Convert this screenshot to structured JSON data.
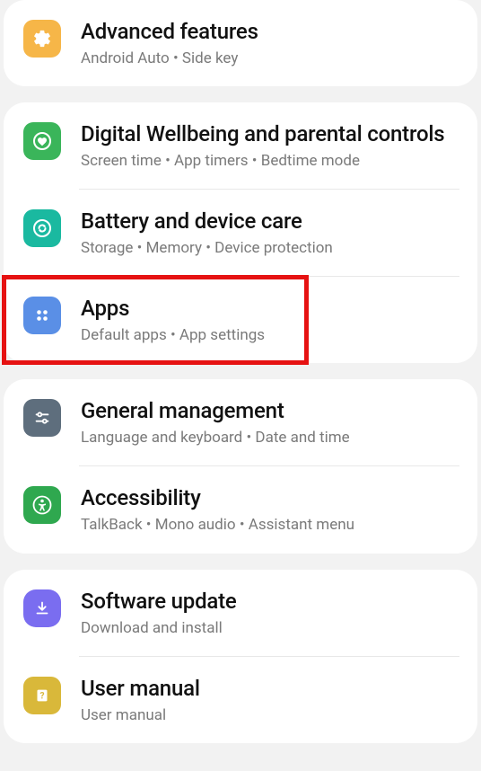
{
  "groups": [
    {
      "items": [
        {
          "title": "Advanced features",
          "subtitle": "Android Auto  •  Side key"
        }
      ]
    },
    {
      "items": [
        {
          "title": "Digital Wellbeing and parental controls",
          "subtitle": "Screen time  •  App timers  •  Bedtime mode"
        },
        {
          "title": "Battery and device care",
          "subtitle": "Storage  •  Memory  •  Device protection"
        },
        {
          "title": "Apps",
          "subtitle": "Default apps  •  App settings",
          "highlighted": true
        }
      ]
    },
    {
      "items": [
        {
          "title": "General management",
          "subtitle": "Language and keyboard  •  Date and time"
        },
        {
          "title": "Accessibility",
          "subtitle": "TalkBack  •  Mono audio  •  Assistant menu"
        }
      ]
    },
    {
      "items": [
        {
          "title": "Software update",
          "subtitle": "Download and install"
        },
        {
          "title": "User manual",
          "subtitle": "User manual"
        }
      ]
    }
  ]
}
